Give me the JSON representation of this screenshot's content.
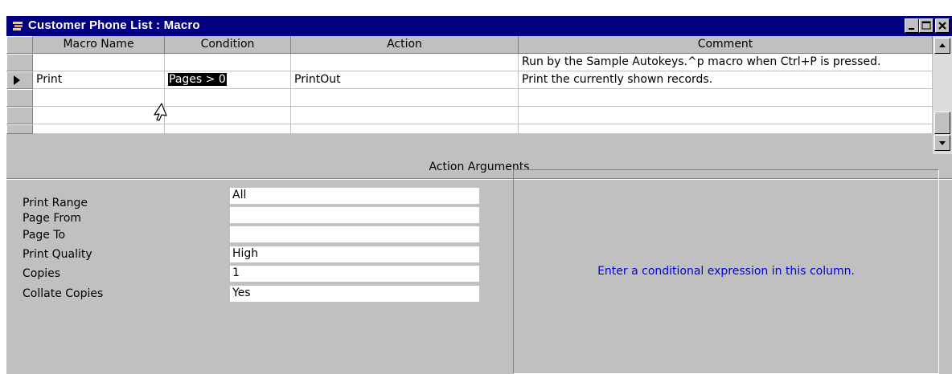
{
  "window": {
    "title": "Customer Phone List : Macro",
    "controls": {
      "minimize_icon": "minimize-icon",
      "restore_icon": "restore-icon",
      "close_icon": "close-icon"
    }
  },
  "grid": {
    "columns": [
      "Macro Name",
      "Condition",
      "Action",
      "Comment"
    ],
    "rows": [
      {
        "indicator": "",
        "macro_name": "",
        "condition": "",
        "action": "",
        "comment": "Run by the Sample Autokeys.^p macro when Ctrl+P is pressed."
      },
      {
        "indicator": "current",
        "macro_name": "Print",
        "condition": "Pages > 0",
        "action": "PrintOut",
        "comment": "Print the currently shown records."
      },
      {
        "indicator": "",
        "macro_name": "",
        "condition": "",
        "action": "",
        "comment": ""
      },
      {
        "indicator": "",
        "macro_name": "",
        "condition": "",
        "action": "",
        "comment": ""
      }
    ]
  },
  "action_arguments": {
    "header": "Action Arguments",
    "fields": [
      {
        "label": "Print Range",
        "value": "All"
      },
      {
        "label": "Page From",
        "value": ""
      },
      {
        "label": "Page To",
        "value": ""
      },
      {
        "label": "Print Quality",
        "value": "High"
      },
      {
        "label": "Copies",
        "value": "1"
      },
      {
        "label": "Collate Copies",
        "value": "Yes"
      }
    ],
    "help_text": "Enter a conditional expression in this column."
  },
  "colors": {
    "titlebar": "#000080",
    "face": "#c0c0c0",
    "help_text": "#0000e0",
    "selection": "#000000"
  }
}
